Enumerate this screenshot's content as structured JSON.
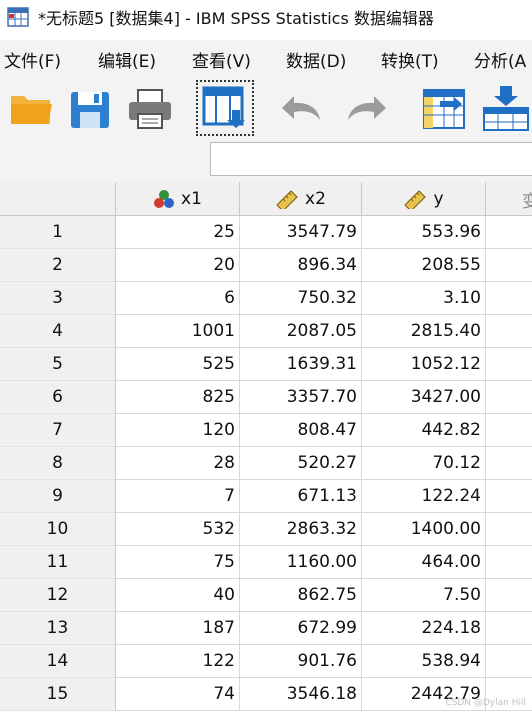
{
  "window": {
    "title": "*无标题5 [数据集4] - IBM SPSS Statistics 数据编辑器"
  },
  "menu": [
    "文件(F)",
    "编辑(E)",
    "查看(V)",
    "数据(D)",
    "转换(T)",
    "分析(A"
  ],
  "toolbar": {
    "icons": [
      "open-folder-icon",
      "save-disk-icon",
      "print-icon",
      "recall-dialog-icon",
      "undo-icon",
      "redo-icon",
      "go-to-case-icon",
      "insert-cases-icon"
    ],
    "cell_editor_value": ""
  },
  "grid": {
    "columns": [
      {
        "name": "x1",
        "icon": "nominal-measure-icon"
      },
      {
        "name": "x2",
        "icon": "scale-ruler-icon"
      },
      {
        "name": "y",
        "icon": "scale-ruler-icon"
      },
      {
        "name": "变",
        "icon": ""
      }
    ],
    "rows": [
      {
        "n": "1",
        "x1": "25",
        "x2": "3547.79",
        "y": "553.96"
      },
      {
        "n": "2",
        "x1": "20",
        "x2": "896.34",
        "y": "208.55"
      },
      {
        "n": "3",
        "x1": "6",
        "x2": "750.32",
        "y": "3.10"
      },
      {
        "n": "4",
        "x1": "1001",
        "x2": "2087.05",
        "y": "2815.40"
      },
      {
        "n": "5",
        "x1": "525",
        "x2": "1639.31",
        "y": "1052.12"
      },
      {
        "n": "6",
        "x1": "825",
        "x2": "3357.70",
        "y": "3427.00"
      },
      {
        "n": "7",
        "x1": "120",
        "x2": "808.47",
        "y": "442.82"
      },
      {
        "n": "8",
        "x1": "28",
        "x2": "520.27",
        "y": "70.12"
      },
      {
        "n": "9",
        "x1": "7",
        "x2": "671.13",
        "y": "122.24"
      },
      {
        "n": "10",
        "x1": "532",
        "x2": "2863.32",
        "y": "1400.00"
      },
      {
        "n": "11",
        "x1": "75",
        "x2": "1160.00",
        "y": "464.00"
      },
      {
        "n": "12",
        "x1": "40",
        "x2": "862.75",
        "y": "7.50"
      },
      {
        "n": "13",
        "x1": "187",
        "x2": "672.99",
        "y": "224.18"
      },
      {
        "n": "14",
        "x1": "122",
        "x2": "901.76",
        "y": "538.94"
      },
      {
        "n": "15",
        "x1": "74",
        "x2": "3546.18",
        "y": "2442.79"
      }
    ]
  },
  "watermark": "CSDN @Dylan Hill",
  "colors": {
    "toolbar_blue": "#1f6fc5",
    "folder_orange": "#f0a21d",
    "header_bg": "#f0f0f0"
  }
}
